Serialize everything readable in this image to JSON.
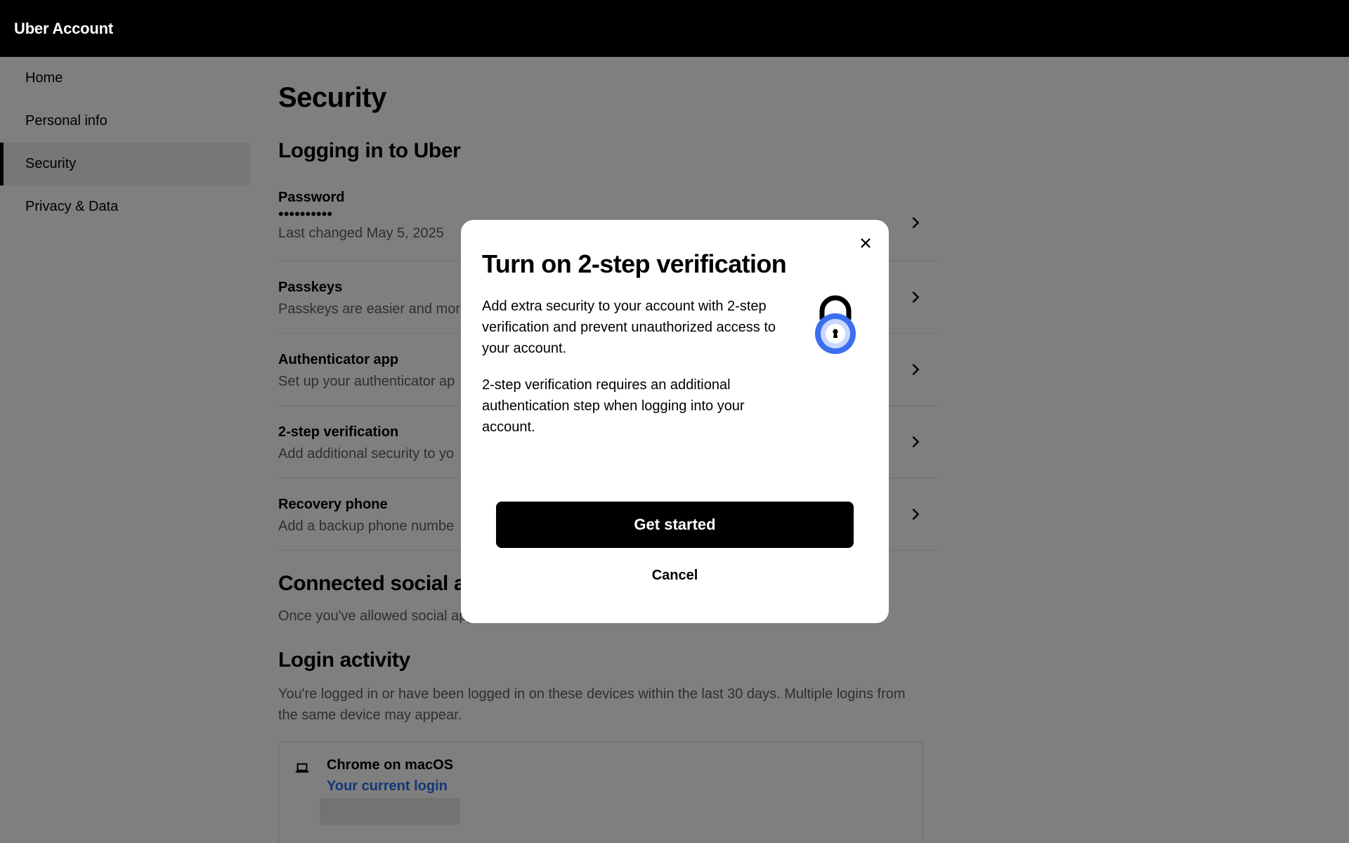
{
  "app": {
    "title": "Uber Account"
  },
  "sidebar": {
    "items": [
      {
        "label": "Home"
      },
      {
        "label": "Personal info"
      },
      {
        "label": "Security",
        "active": true
      },
      {
        "label": "Privacy & Data"
      }
    ]
  },
  "main": {
    "title": "Security",
    "login_section": {
      "title": "Logging in to Uber",
      "password": {
        "title": "Password",
        "masked": "••••••••••",
        "desc": "Last changed May 5, 2025"
      },
      "passkeys": {
        "title": "Passkeys",
        "desc": "Passkeys are easier and mor"
      },
      "authenticator": {
        "title": "Authenticator app",
        "desc": "Set up your authenticator ap"
      },
      "two_step": {
        "title": "2-step verification",
        "desc": "Add additional security to yo"
      },
      "recovery": {
        "title": "Recovery phone",
        "desc": "Add a backup phone numbe"
      }
    },
    "social_section": {
      "title": "Connected social a",
      "desc": "Once you've allowed social apps to sign in to your Uber account, you'll see them here."
    },
    "activity_section": {
      "title": "Login activity",
      "desc": "You're logged in or have been logged in on these devices within the last 30 days. Multiple logins from the same device may appear.",
      "device": {
        "name": "Chrome on macOS",
        "current": "Your current login"
      }
    }
  },
  "modal": {
    "title": "Turn on 2-step verification",
    "p1": "Add extra security to your account with 2-step verification and prevent unauthorized access to your account.",
    "p2": "2-step verification requires an additional authentication step when logging into your account.",
    "primary_label": "Get started",
    "cancel_label": "Cancel",
    "icons": {
      "close": "close-icon",
      "lock": "lock-icon"
    }
  },
  "colors": {
    "topbar": "#000000",
    "accent_link": "#276ef1",
    "lock_blue": "#3b6ff0",
    "lock_light": "#c9d8ff",
    "overlay": "rgba(0,0,0,0.5)"
  }
}
